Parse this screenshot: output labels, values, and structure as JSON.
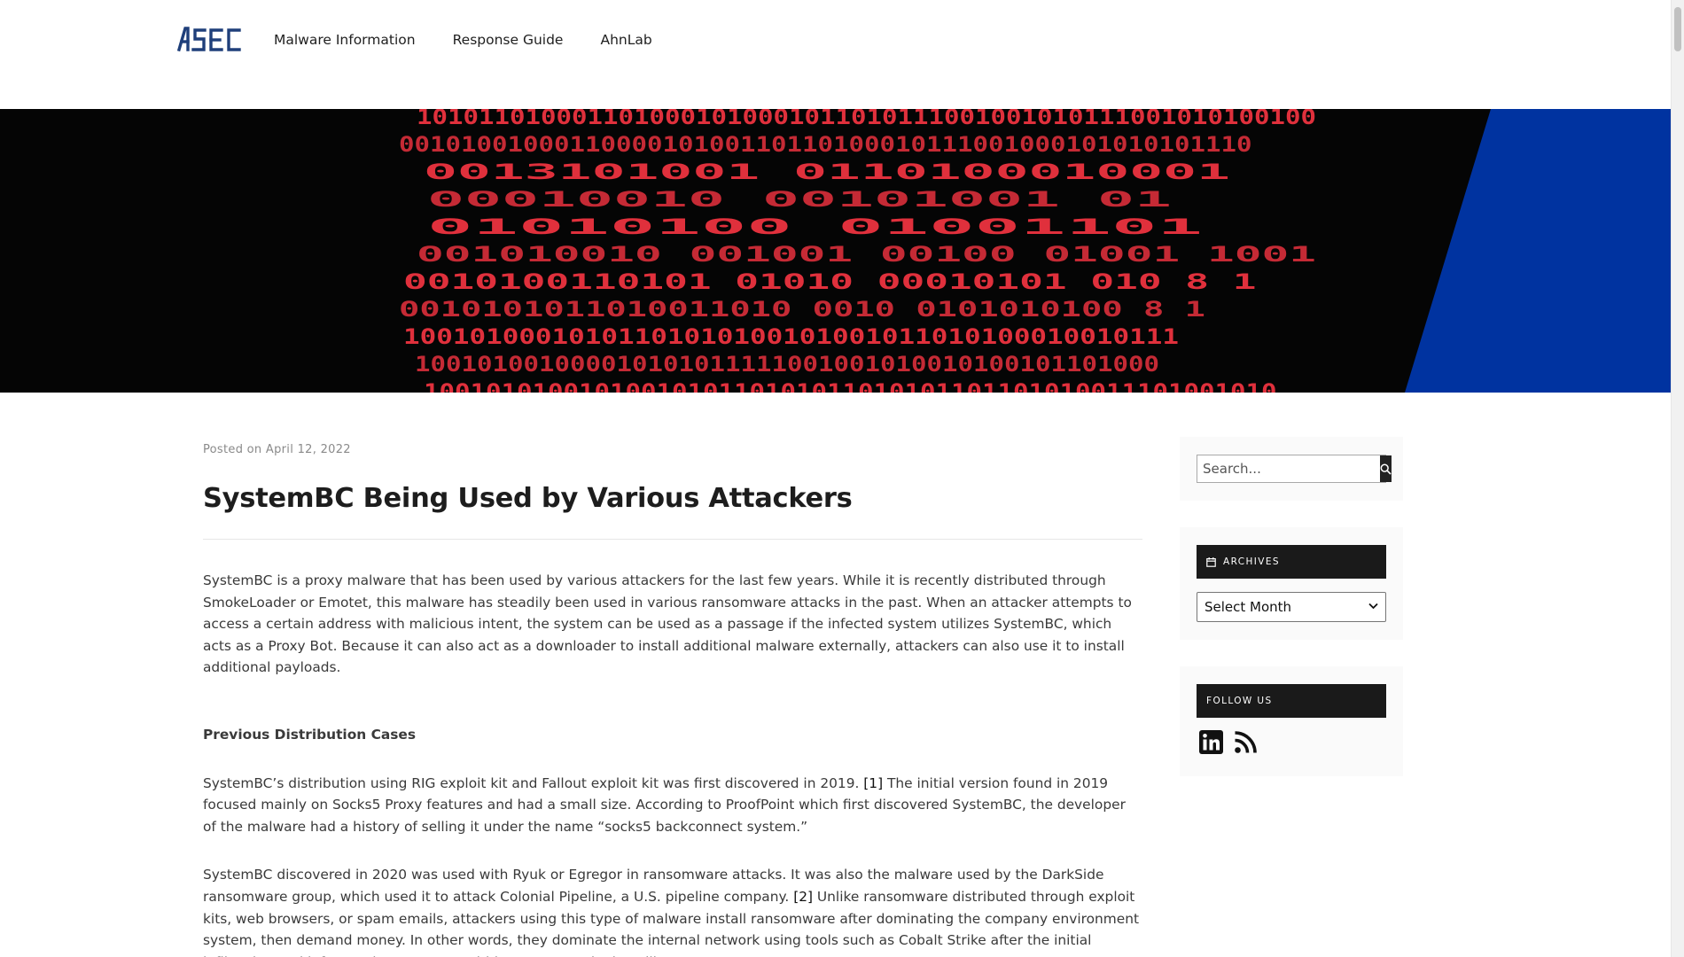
{
  "header": {
    "logo_text": "ASEC",
    "nav": [
      "Malware Information",
      "Response Guide",
      "AhnLab"
    ]
  },
  "hero": {
    "binary_rows": [
      "1010110100011010001010001011010111001001010111001010100100",
      "0010100100011000010100110110100010111001000101010101110",
      "0013101001            0110100010001                 ",
      "00010010              00101001  01              ",
      "01010100              01001101                    ",
      "001010010             001001    00100      01001      1001",
      "0010100110101        01010     00010101    010   8    1",
      "0010101011010011010   0010   0101010100         8  1",
      "10010100010101101010100101001011010100010010111   ",
      "100101001000010101011111001001010010100101101000",
      "1001010100101001010110101011010101101101010011101001010"
    ]
  },
  "article": {
    "posted_prefix": "Posted on",
    "posted_date": "April 12, 2022",
    "title": "SystemBC Being Used by Various Attackers",
    "p1": "SystemBC is a proxy malware that has been used by various attackers for the last few years. While it is recently distributed through SmokeLoader or Emotet, this malware has steadily been used in various ransomware attacks in the past. When an attacker attempts to access a certain address with malicious intent, the system can be used as a passage if the infected system utilizes SystemBC, which acts as a Proxy Bot. Because it can also act as a downloader to install additional malware externally, attackers can also use it to install additional payloads.",
    "section_head": "Previous Distribution Cases",
    "p2_a": "SystemBC’s distribution using RIG exploit kit and Fallout exploit kit was first discovered in 2019. ",
    "p2_ref": "[1]",
    "p2_b": " The initial version found in 2019 focused mainly on Socks5 Proxy features and had a small size. According to ProofPoint which first discovered SystemBC, the developer of the malware had a history of selling it under the name “socks5 backconnect system.”",
    "p3_a": "SystemBC discovered in 2020 was used with Ryuk or Egregor in ransomware attacks. It was also the malware used by the DarkSide ransomware group, which used it to attack Colonial Pipeline, a U.S. pipeline company. ",
    "p3_ref": "[2]",
    "p3_b": " Unlike ransomware distributed through exploit kits, web browsers, or spam emails, attackers using this type of malware install ransomware after dominating the company environment system, then demand money. In other words, they dominate the internal network using tools such as Cobalt Strike after the initial infiltration and infect various systems within a company by installing ransomware."
  },
  "sidebar": {
    "search_placeholder": "Search...",
    "archives_title": "ARCHIVES",
    "archives_select": "Select Month",
    "follow_title": "FOLLOW US",
    "social": [
      "linkedin-icon",
      "rss-icon"
    ]
  },
  "colors": {
    "accent_blue": "#0033a0",
    "binary_red": "#e0303c",
    "dark_widget": "#1a1a1a"
  }
}
